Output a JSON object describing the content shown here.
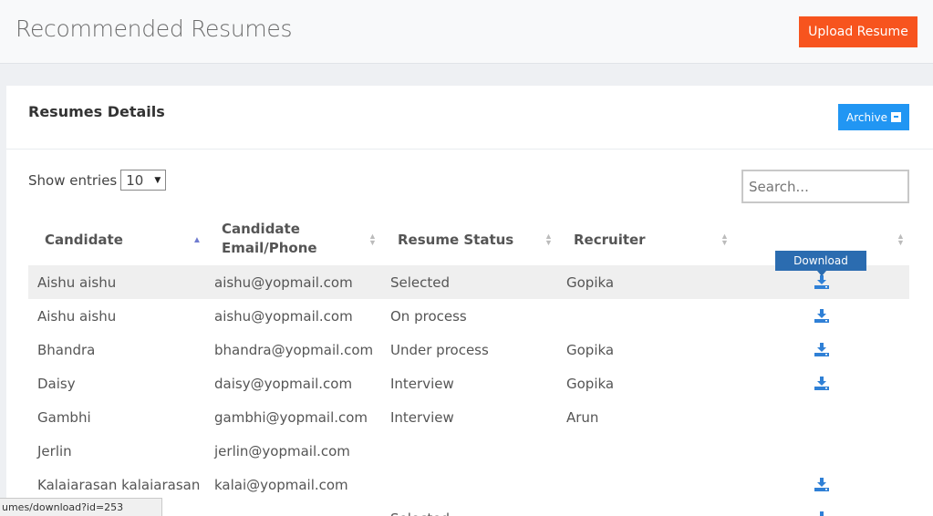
{
  "header": {
    "title": "Recommended Resumes",
    "upload_label": "Upload Resume"
  },
  "panel": {
    "title": "Resumes Details",
    "archive_label": "Archive"
  },
  "controls": {
    "show_label": "Show entries",
    "entries_value": "10",
    "search_placeholder": "Search..."
  },
  "table": {
    "headers": [
      "Candidate",
      "Candidate Email/Phone",
      "Resume Status",
      "Recruiter",
      ""
    ],
    "header_email_line1": "Candidate",
    "header_email_line2": "Email/Phone",
    "sorted_column": "Candidate",
    "sort_direction": "ascending",
    "rows": [
      {
        "candidate": "Aishu aishu",
        "email": "aishu@yopmail.com",
        "status": "Selected",
        "recruiter": "Gopika",
        "download": true
      },
      {
        "candidate": "Aishu aishu",
        "email": "aishu@yopmail.com",
        "status": "On process",
        "recruiter": "",
        "download": true
      },
      {
        "candidate": "Bhandra",
        "email": "bhandra@yopmail.com",
        "status": "Under process",
        "recruiter": "Gopika",
        "download": true
      },
      {
        "candidate": "Daisy",
        "email": "daisy@yopmail.com",
        "status": "Interview",
        "recruiter": "Gopika",
        "download": true
      },
      {
        "candidate": "Gambhi",
        "email": "gambhi@yopmail.com",
        "status": "Interview",
        "recruiter": "Arun",
        "download": false
      },
      {
        "candidate": "Jerlin",
        "email": "jerlin@yopmail.com",
        "status": "",
        "recruiter": "",
        "download": false
      },
      {
        "candidate": "Kalaiarasan kalaiarasan",
        "email": "kalai@yopmail.com",
        "status": "",
        "recruiter": "",
        "download": true
      },
      {
        "candidate": "",
        "email": "",
        "status": "Selected",
        "recruiter": "",
        "download": true
      }
    ]
  },
  "tooltip": "Download",
  "status_url": "umes/download?id=253",
  "colors": {
    "upload": "#f7541e",
    "archive": "#2196f3",
    "download_icon": "#2f80d6",
    "tooltip": "#2b6cb0"
  },
  "icons": {
    "download": "download-icon",
    "archive": "archive-icon",
    "sort": "sort-both-icon",
    "sort_asc": "sort-asc-icon",
    "select_caret": "chevron-down-icon"
  }
}
